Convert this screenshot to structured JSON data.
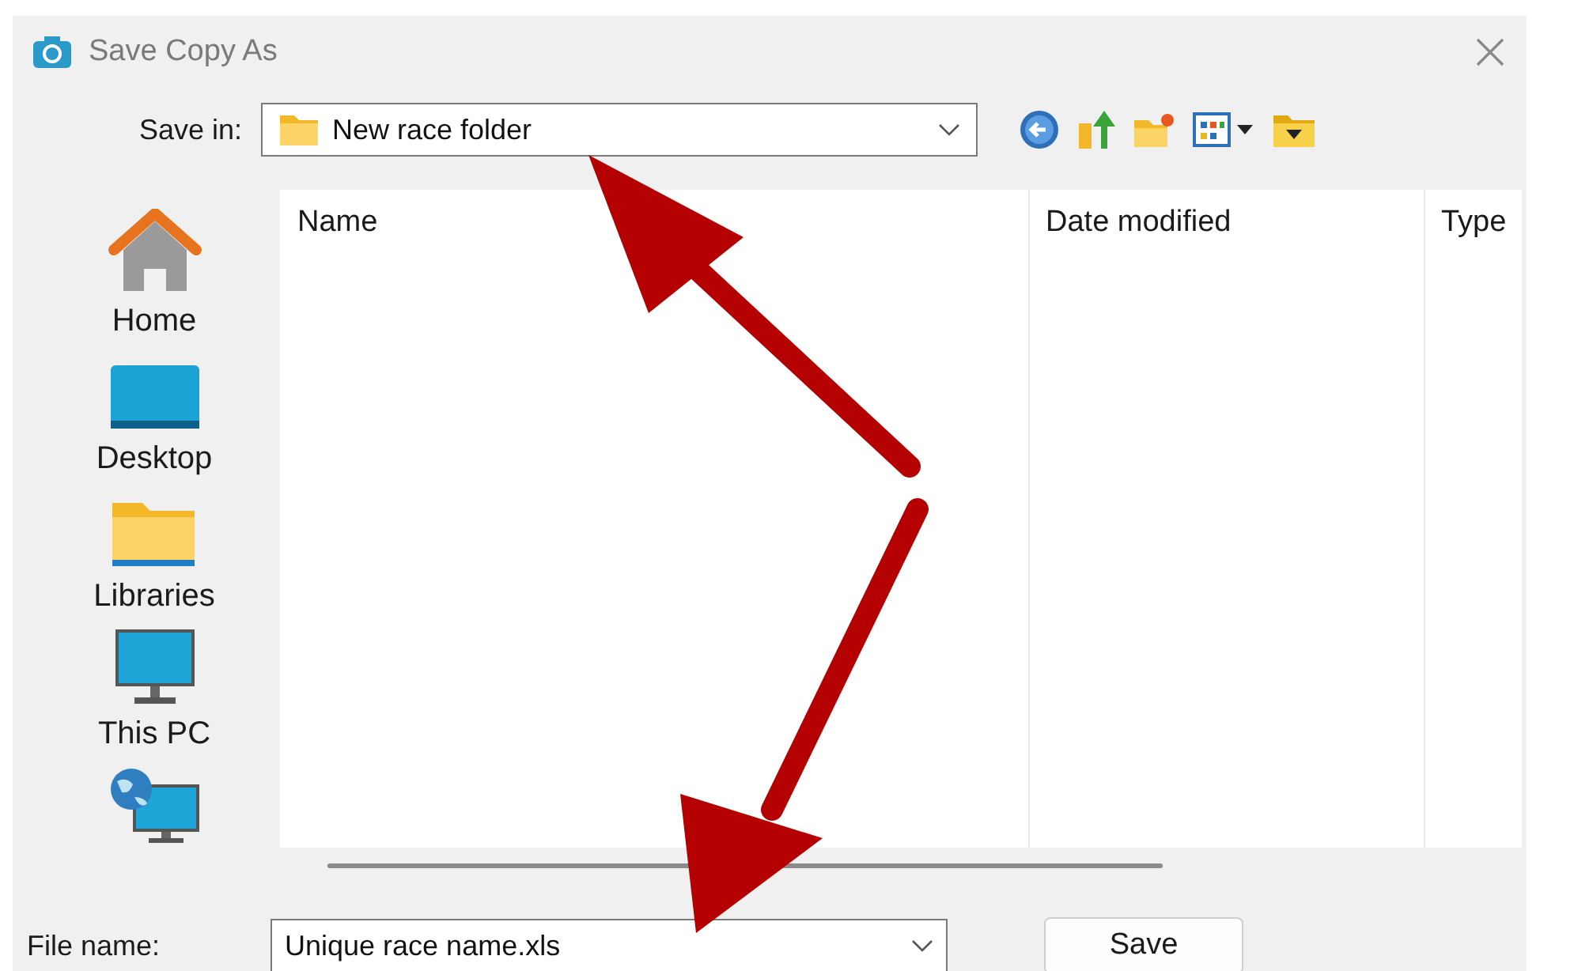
{
  "window": {
    "title": "Save Copy As"
  },
  "save_in": {
    "label": "Save in:",
    "value": "New race folder"
  },
  "places": [
    {
      "kind": "home",
      "label": "Home"
    },
    {
      "kind": "desktop",
      "label": "Desktop"
    },
    {
      "kind": "libraries",
      "label": "Libraries"
    },
    {
      "kind": "pc",
      "label": "This PC"
    },
    {
      "kind": "network"
    }
  ],
  "file_list": {
    "columns": [
      "Name",
      "Date modified",
      "Type"
    ]
  },
  "file_name": {
    "label": "File name:",
    "value": "Unique race name.xls"
  },
  "buttons": [
    {
      "label": "Save"
    }
  ]
}
